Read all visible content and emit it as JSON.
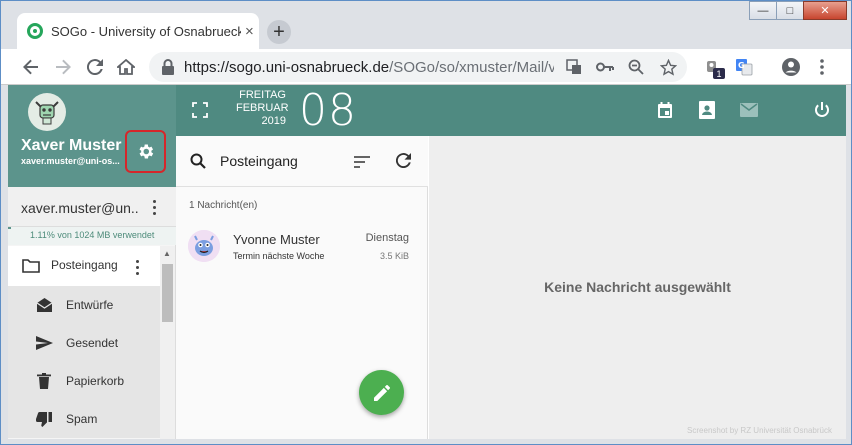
{
  "browser": {
    "tab_title": "SOGo - University of Osnabrueck",
    "tab_close": "×",
    "new_tab": "+",
    "url_host": "https://sogo.uni-osnabrueck.de",
    "url_path": "/SOGo/so/xmuster/Mail/vi...",
    "ext_badge": "1",
    "window": {
      "minimize": "—",
      "maximize": "□",
      "close": "✕"
    }
  },
  "sidebar": {
    "user_name": "Xaver Muster",
    "user_email": "xaver.muster@uni-os...",
    "account_label": "xaver.muster@un...",
    "quota_text": "1.11% von 1024 MB verwendet",
    "quota_percent": 1.11,
    "inbox_label": "Posteingang",
    "folders": [
      {
        "label": "Entwürfe",
        "icon": "drafts-icon"
      },
      {
        "label": "Gesendet",
        "icon": "send-icon"
      },
      {
        "label": "Papierkorb",
        "icon": "trash-icon"
      },
      {
        "label": "Spam",
        "icon": "thumb-down-icon"
      }
    ]
  },
  "topbar": {
    "weekday": "FREITAG",
    "month": "FEBRUAR",
    "year": "2019",
    "day": "08"
  },
  "list": {
    "title": "Posteingang",
    "count": "1 Nachricht(en)",
    "messages": [
      {
        "from": "Yvonne Muster",
        "subject": "Termin nächste Woche",
        "date": "Dienstag",
        "size": "3.5 KiB"
      }
    ]
  },
  "viewer": {
    "empty_text": "Keine Nachricht ausgewählt",
    "credit": "Screenshot by RZ Universität Osnabrück"
  },
  "colors": {
    "accent": "#4f8a81",
    "fab": "#4caf50",
    "highlight": "#d6262a"
  }
}
